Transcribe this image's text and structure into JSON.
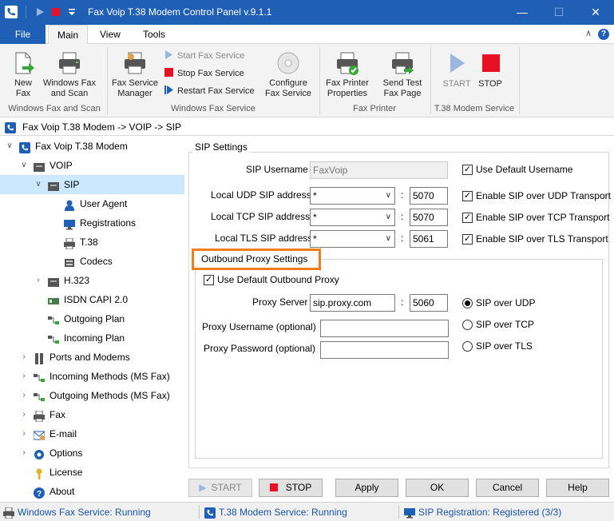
{
  "window": {
    "title": "Fax Voip T.38 Modem Control Panel v.9.1.1",
    "minimize": "—",
    "maximize": "☐",
    "close": "✕"
  },
  "ribbon_tabs": {
    "file": "File",
    "main": "Main",
    "view": "View",
    "tools": "Tools"
  },
  "ribbon": {
    "new_fax": "New Fax",
    "windows_fax_scan": "Windows Fax and Scan",
    "group1": "Windows Fax and Scan",
    "fax_service_manager": "Fax Service Manager",
    "start_fax_service": "Start Fax Service",
    "stop_fax_service": "Stop Fax Service",
    "restart_fax_service": "Restart Fax Service",
    "configure_fax_service": "Configure Fax Service",
    "group2": "Windows Fax Service",
    "fax_printer_properties": "Fax Printer Properties",
    "send_test_fax_page": "Send Test Fax Page",
    "group3": "Fax Printer",
    "start": "START",
    "stop": "STOP",
    "group4": "T.38 Modem Service"
  },
  "breadcrumb": "Fax Voip T.38 Modem -> VOIP -> SIP",
  "tree": {
    "root": "Fax Voip T.38 Modem",
    "voip": "VOIP",
    "sip": "SIP",
    "user_agent": "User Agent",
    "registrations": "Registrations",
    "t38": "T.38",
    "codecs": "Codecs",
    "h323": "H.323",
    "isdn": "ISDN CAPI 2.0",
    "outgoing_plan": "Outgoing Plan",
    "incoming_plan": "Incoming Plan",
    "ports_modems": "Ports and Modems",
    "incoming_methods": "Incoming Methods (MS Fax)",
    "outgoing_methods": "Outgoing Methods (MS Fax)",
    "fax": "Fax",
    "email": "E-mail",
    "options": "Options",
    "license": "License",
    "about": "About"
  },
  "sip": {
    "section_title": "SIP Settings",
    "username_label": "SIP Username",
    "username_value": "FaxVoip",
    "use_default_username": "Use Default Username",
    "udp_label": "Local UDP SIP address",
    "udp_addr": "*",
    "udp_port": "5070",
    "udp_enable": "Enable SIP over UDP Transport",
    "tcp_label": "Local TCP SIP address",
    "tcp_addr": "*",
    "tcp_port": "5070",
    "tcp_enable": "Enable SIP over TCP  Transport",
    "tls_label": "Local TLS SIP address",
    "tls_addr": "*",
    "tls_port": "5061",
    "tls_enable": "Enable SIP over TLS  Transport",
    "colon": ":"
  },
  "proxy": {
    "section_title": "Outbound Proxy Settings",
    "use_default": "Use Default Outbound Proxy",
    "server_label": "Proxy Server",
    "server_value": "sip.proxy.com",
    "server_port": "5060",
    "username_label": "Proxy Username (optional)",
    "password_label": "Proxy Password (optional)",
    "opt_udp": "SIP over UDP",
    "opt_tcp": "SIP over TCP",
    "opt_tls": "SIP over TLS"
  },
  "buttons": {
    "start": "START",
    "stop": "STOP",
    "apply": "Apply",
    "ok": "OK",
    "cancel": "Cancel",
    "help": "Help"
  },
  "status": {
    "fax_service": "Windows Fax Service: Running",
    "modem_service": "T.38 Modem Service: Running",
    "sip_registration": "SIP Registration: Registered (3/3)"
  },
  "colors": {
    "accent": "#1f5fb5",
    "highlight": "#f07e18",
    "selected": "#cce8ff",
    "stop_red": "#e81123"
  }
}
